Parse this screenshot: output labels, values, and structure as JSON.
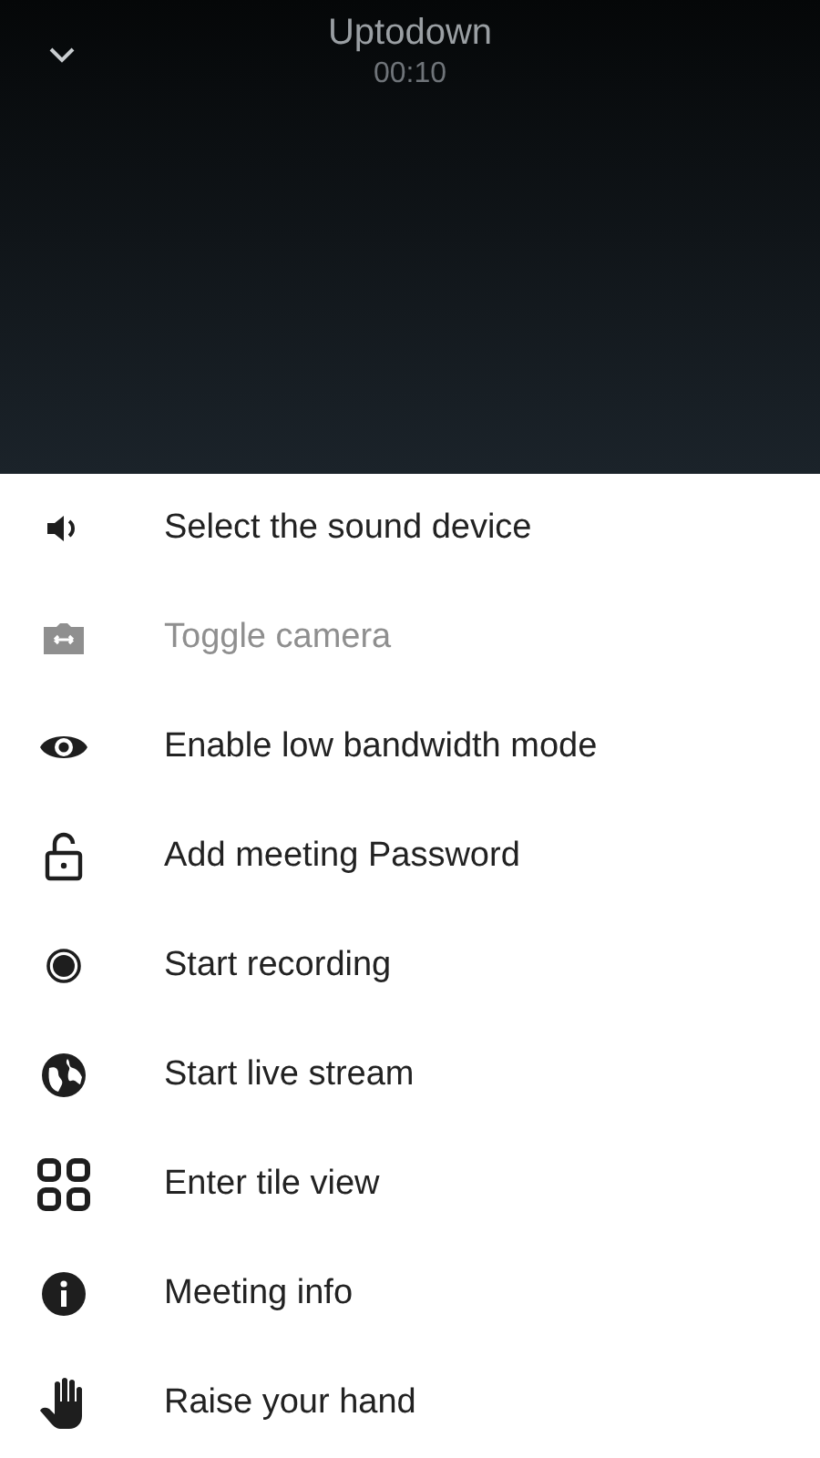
{
  "call": {
    "title": "Uptodown",
    "duration": "00:10"
  },
  "menu": [
    {
      "kind": "sound",
      "label": "Select the sound device",
      "disabled": false
    },
    {
      "kind": "camera",
      "label": "Toggle camera",
      "disabled": true
    },
    {
      "kind": "eye",
      "label": "Enable low bandwidth mode",
      "disabled": false
    },
    {
      "kind": "lock",
      "label": "Add meeting Password",
      "disabled": false
    },
    {
      "kind": "record",
      "label": "Start recording",
      "disabled": false
    },
    {
      "kind": "globe",
      "label": "Start live stream",
      "disabled": false
    },
    {
      "kind": "tiles",
      "label": "Enter tile view",
      "disabled": false
    },
    {
      "kind": "info",
      "label": "Meeting info",
      "disabled": false
    },
    {
      "kind": "hand",
      "label": "Raise your hand",
      "disabled": false
    }
  ]
}
